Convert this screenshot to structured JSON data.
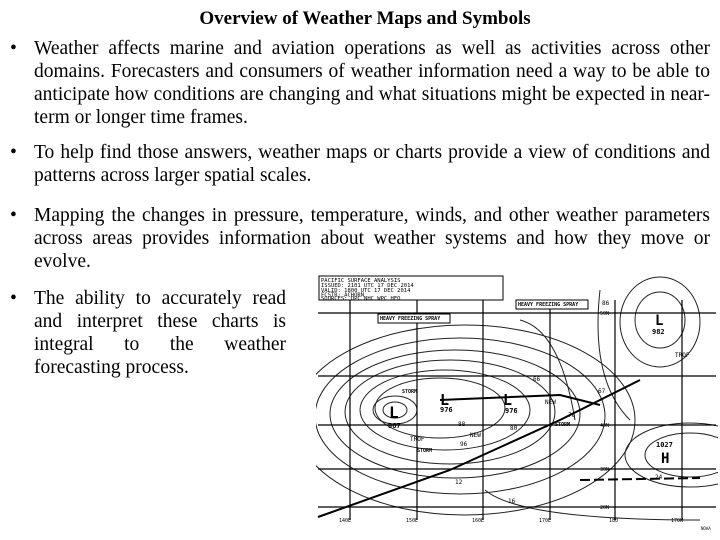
{
  "title": "Overview of Weather Maps and Symbols",
  "bullets": [
    {
      "symbol": "•",
      "text": "Weather affects marine and aviation operations as well as activities across other domains. Forecasters and consumers of weather information need a way to be able to anticipate how conditions are changing and what situations might be expected in near-term or longer time frames."
    },
    {
      "symbol": "•",
      "text": "To help find those answers, weather maps or charts provide a view of conditions and patterns across larger spatial scales."
    },
    {
      "symbol": "•",
      "text": "Mapping the changes in pressure, temperature, winds, and other weather parameters across areas provides information about weather systems and how they move or evolve."
    },
    {
      "symbol": "•",
      "text": "The ability to accurately read and interpret these charts is integral to the weather forecasting process."
    }
  ],
  "map": {
    "header": [
      "PACIFIC SURFACE ANALYSIS",
      "ISSUED: 2101 UTC 17 DEC 2014",
      "VALID: 1800 UTC 17 DEC 2014",
      "FCSTR: ACHORN",
      "SOURCES: OPC NHC WPC HFO"
    ],
    "warnings": [
      "HEAVY FREEZING SPRAY",
      "HEAVY FREEZING SPRAY",
      "STORM",
      "STORM",
      "STORM"
    ],
    "lows": [
      {
        "symbol": "L",
        "pressure": "967"
      },
      {
        "symbol": "L",
        "pressure": "976"
      },
      {
        "symbol": "L",
        "pressure": "976"
      },
      {
        "symbol": "L",
        "pressure": "982"
      }
    ],
    "highs": [
      {
        "symbol": "H",
        "pressure": "1027"
      }
    ],
    "labels": [
      "TROF",
      "TROF",
      "NEW",
      "NEW",
      "66",
      "67",
      "76",
      "80",
      "88",
      "96",
      "86",
      "12",
      "16",
      "24"
    ],
    "longitudes": [
      "140E",
      "150E",
      "160E",
      "170E",
      "180",
      "170W"
    ],
    "latitudes": [
      "50N",
      "40N",
      "30N",
      "20N"
    ],
    "credit": "NOAA"
  }
}
